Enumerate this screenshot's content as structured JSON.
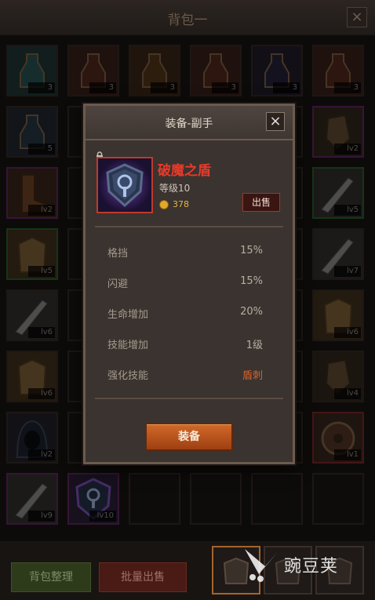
{
  "window": {
    "title": "背包一"
  },
  "inventory": {
    "slots": [
      {
        "badge": "3",
        "type": "potion",
        "color": "#2a5a5a",
        "border": "#3a2f29"
      },
      {
        "badge": "3",
        "type": "potion",
        "color": "#5a2a20",
        "border": "#3a2f29"
      },
      {
        "badge": "3",
        "type": "potion",
        "color": "#5a3a1a",
        "border": "#3a2f29"
      },
      {
        "badge": "3",
        "type": "potion",
        "color": "#5a2a20",
        "border": "#3a2f29"
      },
      {
        "badge": "3",
        "type": "potion",
        "color": "#2a2540",
        "border": "#3a2f29"
      },
      {
        "badge": "3",
        "type": "potion",
        "color": "#5a2a20",
        "border": "#3a2f29"
      },
      {
        "badge": "5",
        "type": "potion",
        "color": "#2a3a4a",
        "border": "#3a2f29"
      },
      {
        "badge": "",
        "type": "empty",
        "color": "",
        "border": "#3a2f29"
      },
      {
        "badge": "",
        "type": "empty",
        "color": "",
        "border": "#3a2f29"
      },
      {
        "badge": "",
        "type": "empty",
        "color": "",
        "border": "#3a2f29"
      },
      {
        "badge": "",
        "type": "empty",
        "color": "",
        "border": "#3a2f29"
      },
      {
        "badge": "lv2",
        "type": "glove",
        "color": "#4a3a2a",
        "border": "#6a2a6a"
      },
      {
        "badge": "lv2",
        "type": "boot",
        "color": "#5a3520",
        "border": "#6a2a6a"
      },
      {
        "badge": "",
        "type": "empty",
        "color": "",
        "border": "#3a2f29"
      },
      {
        "badge": "",
        "type": "empty",
        "color": "",
        "border": "#3a2f29"
      },
      {
        "badge": "",
        "type": "empty",
        "color": "",
        "border": "#3a2f29"
      },
      {
        "badge": "",
        "type": "empty",
        "color": "",
        "border": "#3a2f29"
      },
      {
        "badge": "lv5",
        "type": "sword",
        "color": "#4a4a4a",
        "border": "#2a6a2a"
      },
      {
        "badge": "lv5",
        "type": "armor",
        "color": "#6a4a28",
        "border": "#2a6a2a"
      },
      {
        "badge": "",
        "type": "empty",
        "color": "",
        "border": "#3a2f29"
      },
      {
        "badge": "",
        "type": "empty",
        "color": "",
        "border": "#3a2f29"
      },
      {
        "badge": "",
        "type": "empty",
        "color": "",
        "border": "#3a2f29"
      },
      {
        "badge": "",
        "type": "empty",
        "color": "",
        "border": "#3a2f29"
      },
      {
        "badge": "lv7",
        "type": "sword",
        "color": "#4a4a4a",
        "border": "#3a2f29"
      },
      {
        "badge": "lv6",
        "type": "sword",
        "color": "#4a4a4a",
        "border": "#3a2f29"
      },
      {
        "badge": "",
        "type": "empty",
        "color": "",
        "border": "#3a2f29"
      },
      {
        "badge": "",
        "type": "empty",
        "color": "",
        "border": "#3a2f29"
      },
      {
        "badge": "",
        "type": "empty",
        "color": "",
        "border": "#3a2f29"
      },
      {
        "badge": "",
        "type": "empty",
        "color": "",
        "border": "#3a2f29"
      },
      {
        "badge": "lv6",
        "type": "armor",
        "color": "#6a4a28",
        "border": "#3a2f29"
      },
      {
        "badge": "lv6",
        "type": "armor",
        "color": "#6a4a28",
        "border": "#3a2f29"
      },
      {
        "badge": "",
        "type": "empty",
        "color": "",
        "border": "#3a2f29"
      },
      {
        "badge": "",
        "type": "empty",
        "color": "",
        "border": "#3a2f29"
      },
      {
        "badge": "",
        "type": "empty",
        "color": "",
        "border": "#3a2f29"
      },
      {
        "badge": "",
        "type": "empty",
        "color": "",
        "border": "#3a2f29"
      },
      {
        "badge": "lv4",
        "type": "glove",
        "color": "#4a3a2a",
        "border": "#3a2f29"
      },
      {
        "badge": "lv2",
        "type": "hood",
        "color": "#2a3040",
        "border": "#3a2f29"
      },
      {
        "badge": "",
        "type": "empty",
        "color": "",
        "border": "#3a2f29"
      },
      {
        "badge": "",
        "type": "empty",
        "color": "",
        "border": "#3a2f29"
      },
      {
        "badge": "",
        "type": "empty",
        "color": "",
        "border": "#3a2f29"
      },
      {
        "badge": "",
        "type": "empty",
        "color": "",
        "border": "#3a2f29"
      },
      {
        "badge": "lv1",
        "type": "shield",
        "color": "#5a3a2a",
        "border": "#8a2a2a"
      },
      {
        "badge": "lv9",
        "type": "sword",
        "color": "#4a4a4a",
        "border": "#6a2a6a"
      },
      {
        "badge": "lv10",
        "type": "shieldp",
        "color": "#3a2a5a",
        "border": "#6a2a6a"
      },
      {
        "badge": "",
        "type": "empty",
        "color": "",
        "border": "#3a2f29"
      },
      {
        "badge": "",
        "type": "empty",
        "color": "",
        "border": "#3a2f29"
      },
      {
        "badge": "",
        "type": "empty",
        "color": "",
        "border": "#3a2f29"
      },
      {
        "badge": "",
        "type": "empty",
        "color": "",
        "border": "#3a2f29"
      }
    ]
  },
  "bottom": {
    "sort_label": "背包整理",
    "batch_sell_label": "批量出售"
  },
  "watermark": {
    "text": "豌豆荚"
  },
  "modal": {
    "title": "装备-副手",
    "item_name": "破魔之盾",
    "item_level": "等级10",
    "price": "378",
    "sell_label": "出售",
    "stats": [
      {
        "label": "格挡",
        "value": "15%",
        "highlight": false
      },
      {
        "label": "闪避",
        "value": "15%",
        "highlight": false
      },
      {
        "label": "生命增加",
        "value": "20%",
        "highlight": false
      },
      {
        "label": "技能增加",
        "value": "1级",
        "highlight": false
      },
      {
        "label": "强化技能",
        "value": "盾刺",
        "highlight": true
      }
    ],
    "equip_label": "装备"
  },
  "colors": {
    "item_name": "#e83a2a",
    "highlight": "#d8622a",
    "equip_button": "#c45f25"
  }
}
